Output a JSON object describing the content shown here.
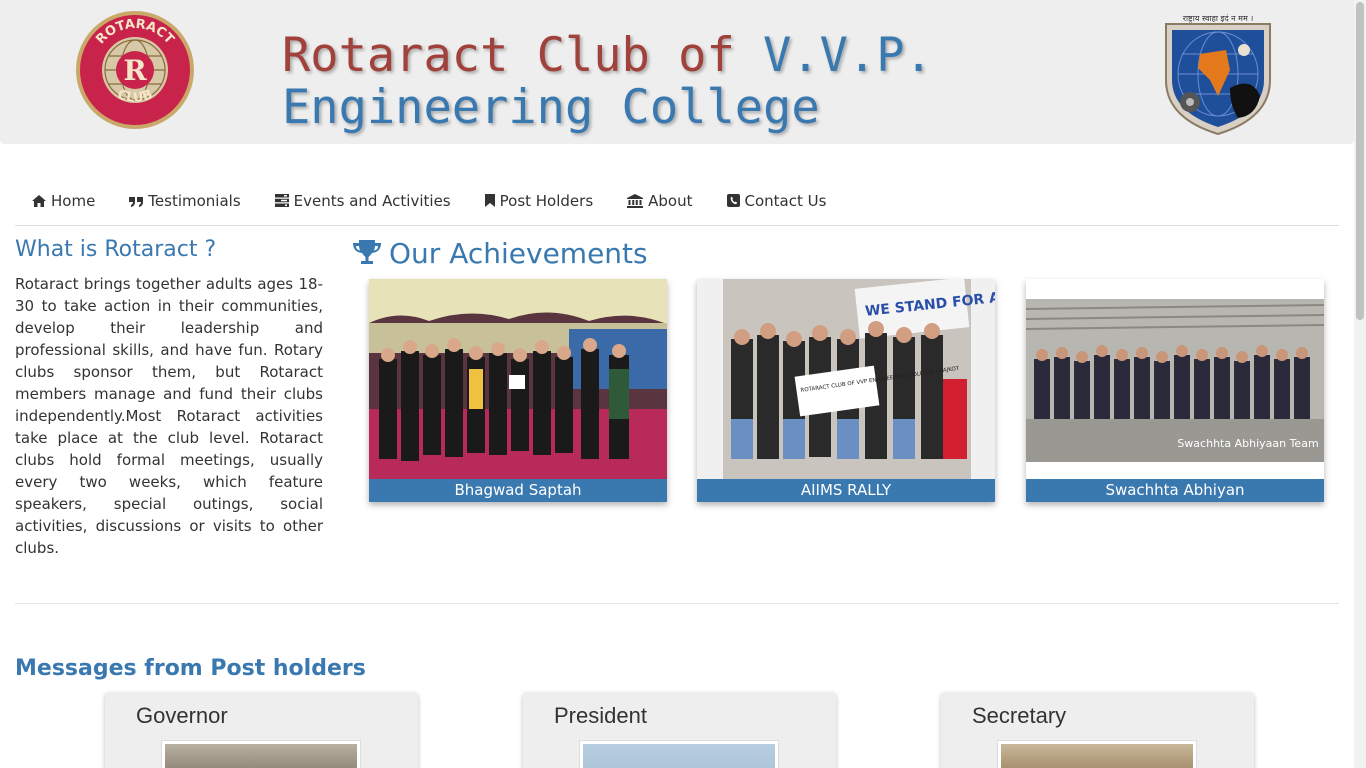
{
  "header": {
    "title_line1_part1": "Rotaract Club of",
    "title_line1_part2": "V.V.P.",
    "title_line2": "Engineering College",
    "logo_text_top": "ROTARACT",
    "logo_text_bottom": "CLUB",
    "logo_letter": "R",
    "emblem_text": "राष्ट्राय स्वाहा इदं न मम ।"
  },
  "nav": {
    "items": [
      {
        "label": "Home",
        "icon": "home-icon"
      },
      {
        "label": "Testimonials",
        "icon": "quote-icon"
      },
      {
        "label": "Events and Activities",
        "icon": "tasks-icon"
      },
      {
        "label": "Post Holders",
        "icon": "bookmark-icon"
      },
      {
        "label": "About",
        "icon": "institution-icon"
      },
      {
        "label": "Contact Us",
        "icon": "phone-icon"
      }
    ]
  },
  "about": {
    "title": "What is Rotaract ?",
    "text": "Rotaract brings together adults ages 18-30 to take action in their communities, develop their leadership and professional skills, and have fun. Rotary clubs sponsor them, but Rotaract members manage and fund their clubs independently.Most Rotaract activities take place at the club level. Rotaract clubs hold formal meetings, usually every two weeks, which feature speakers, special outings, social activities, discussions or visits to other clubs."
  },
  "achievements": {
    "title": "Our Achievements",
    "cards": [
      {
        "caption": "Bhagwad Saptah"
      },
      {
        "caption": "AIIMS RALLY",
        "banner_text": "WE STAND FOR AIIMS",
        "sign_text": "ROTARACT CLUB OF VVP ENGINEERING COLLEGE - RAJKOT"
      },
      {
        "caption": "Swachhta Abhiyan",
        "overlay_text": "Swachhta Abhiyaan Team"
      }
    ]
  },
  "messages": {
    "title": "Messages from Post holders",
    "cards": [
      {
        "role": "Governor"
      },
      {
        "role": "President"
      },
      {
        "role": "Secretary"
      }
    ]
  },
  "colors": {
    "accent": "#3a78b0",
    "title_red": "#a0413c",
    "header_bg": "#eeeeee"
  }
}
